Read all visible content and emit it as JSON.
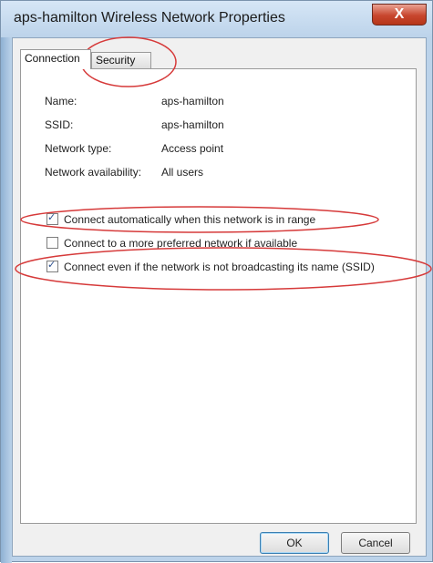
{
  "window": {
    "title": "aps-hamilton Wireless Network Properties",
    "close_symbol": "X"
  },
  "tabs": [
    {
      "label": "Connection",
      "selected": true
    },
    {
      "label": "Security",
      "selected": false
    }
  ],
  "properties": [
    {
      "label": "Name:",
      "value": "aps-hamilton"
    },
    {
      "label": "SSID:",
      "value": "aps-hamilton"
    },
    {
      "label": "Network type:",
      "value": "Access point"
    },
    {
      "label": "Network availability:",
      "value": "All users"
    }
  ],
  "options": [
    {
      "label": "Connect automatically when this network is in range",
      "checked": true
    },
    {
      "label": "Connect to a more preferred network if available",
      "checked": false
    },
    {
      "label": "Connect even if the network is not broadcasting its name (SSID)",
      "checked": true
    }
  ],
  "buttons": {
    "ok": "OK",
    "cancel": "Cancel"
  },
  "check_symbol": "✓",
  "colors": {
    "annotation": "#d63a3a",
    "title_bar": "#bcd3ea",
    "close_button": "#c8462e"
  }
}
